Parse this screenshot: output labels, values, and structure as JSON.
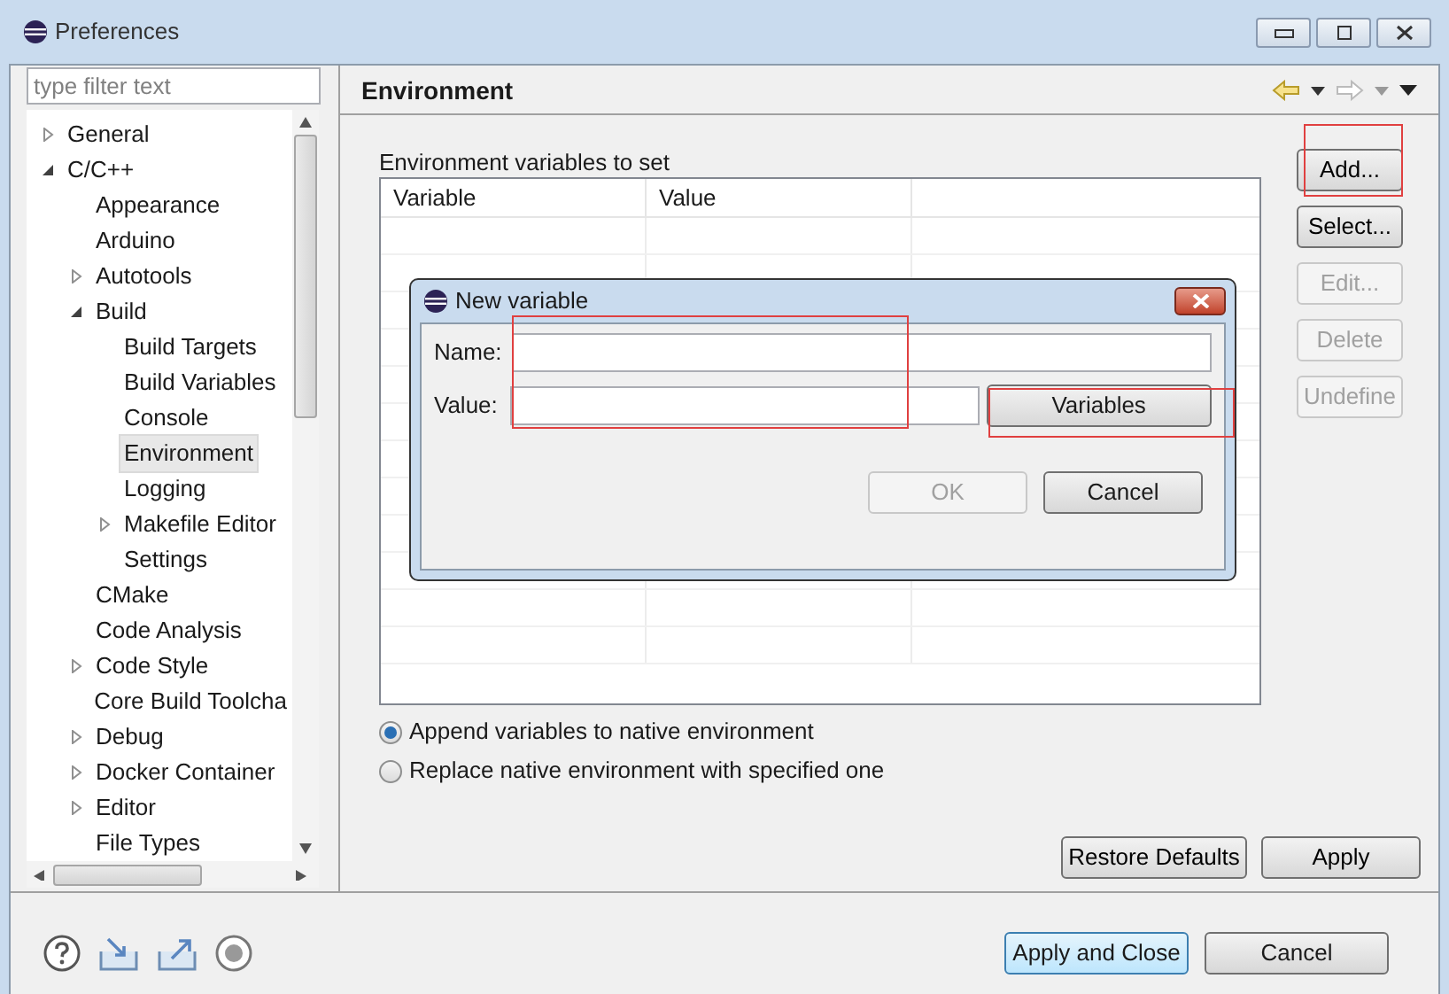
{
  "window": {
    "title": "Preferences"
  },
  "filter": {
    "placeholder": "type filter text"
  },
  "tree": [
    {
      "label": "General",
      "expanded": false,
      "selected": false
    },
    {
      "label": "C/C++",
      "expanded": true,
      "selected": false,
      "children": [
        {
          "label": "Appearance",
          "selected": false
        },
        {
          "label": "Arduino",
          "selected": false
        },
        {
          "label": "Autotools",
          "expanded": false,
          "selected": false
        },
        {
          "label": "Build",
          "expanded": true,
          "selected": false,
          "children": [
            {
              "label": "Build Targets",
              "selected": false
            },
            {
              "label": "Build Variables",
              "selected": false
            },
            {
              "label": "Console",
              "selected": false
            },
            {
              "label": "Environment",
              "selected": true
            },
            {
              "label": "Logging",
              "selected": false
            },
            {
              "label": "Makefile Editor",
              "expanded": false,
              "selected": false
            },
            {
              "label": "Settings",
              "selected": false
            }
          ]
        },
        {
          "label": "CMake",
          "selected": false
        },
        {
          "label": "Code Analysis",
          "selected": false
        },
        {
          "label": "Code Style",
          "expanded": false,
          "selected": false
        },
        {
          "label": "Core Build Toolcha",
          "selected": false
        },
        {
          "label": "Debug",
          "expanded": false,
          "selected": false
        },
        {
          "label": "Docker Container",
          "expanded": false,
          "selected": false
        },
        {
          "label": "Editor",
          "expanded": false,
          "selected": false
        },
        {
          "label": "File Types",
          "selected": false
        }
      ]
    }
  ],
  "page": {
    "title": "Environment",
    "table_label": "Environment variables to set",
    "columns": [
      "Variable",
      "Value"
    ],
    "side_buttons": [
      {
        "label": "Add...",
        "disabled": false,
        "highlighted": true
      },
      {
        "label": "Select...",
        "disabled": false,
        "highlighted": false
      },
      {
        "label": "Edit...",
        "disabled": true,
        "highlighted": false
      },
      {
        "label": "Delete",
        "disabled": true,
        "highlighted": false
      },
      {
        "label": "Undefine",
        "disabled": true,
        "highlighted": false
      }
    ],
    "options": [
      {
        "label": "Append variables to native environment",
        "selected": true
      },
      {
        "label": "Replace native environment with specified one",
        "selected": false
      }
    ],
    "buttons": [
      "Restore Defaults",
      "Apply"
    ]
  },
  "dialog": {
    "title": "New variable",
    "name_label": "Name:",
    "value_label": "Value:",
    "fields_highlighted": true,
    "variables_button": {
      "label": "Variables",
      "highlighted": true
    },
    "buttons": [
      {
        "label": "OK",
        "disabled": true
      },
      {
        "label": "Cancel",
        "disabled": false
      }
    ]
  },
  "footer_buttons": [
    {
      "label": "Apply and Close",
      "default": true
    },
    {
      "label": "Cancel",
      "default": false
    }
  ]
}
